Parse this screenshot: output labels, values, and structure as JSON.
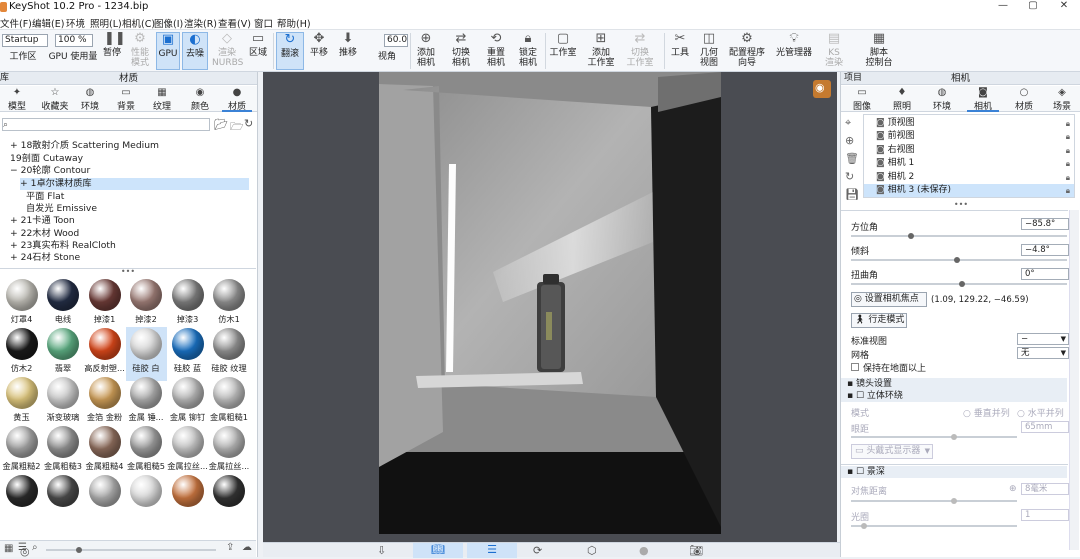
{
  "window": {
    "title": "KeyShot 10.2 Pro  - 1234.bip",
    "controls": [
      "—",
      "▢",
      "✕"
    ]
  },
  "menu": [
    "文件(F)",
    "编辑(E)",
    "环境",
    "照明(L)",
    "相机(C)",
    "图像(I)",
    "渲染(R)",
    "查看(V)",
    "窗口",
    "帮助(H)"
  ],
  "toolbar": {
    "startup": "Startup",
    "zoom": "100 %",
    "fov": "60.0",
    "items": [
      "工作区",
      "GPU 使用量",
      "暂停",
      "性能\n模式",
      "GPU",
      "去噪",
      "渲染\nNURBS",
      "区域",
      "翻滚",
      "平移",
      "推移",
      "视角",
      "添加\n相机",
      "切换\n相机",
      "重置\n相机",
      "锁定\n相机",
      "工作室",
      "添加\n工作室",
      "切换\n工作室",
      "工具",
      "几何\n视图",
      "配置程序\n向导",
      "光管理器",
      "KS\n渲染",
      "脚本\n控制台"
    ]
  },
  "left": {
    "header": "材质",
    "left_header": "库",
    "tabs": [
      "模型",
      "收藏夹",
      "环境",
      "背景",
      "纹理",
      "颜色",
      "材质"
    ],
    "search_placeholder": "",
    "tree": [
      {
        "label": "+ 18散射介质 Scattering Medium",
        "indent": 0
      },
      {
        "label": "19剖面 Cutaway",
        "indent": 0
      },
      {
        "label": "− 20轮廓 Contour",
        "indent": 0
      },
      {
        "label": "+ 1卓尔课材质库",
        "indent": 1,
        "highlight": true
      },
      {
        "label": "平面 Flat",
        "indent": 1
      },
      {
        "label": "自发光 Emissive",
        "indent": 1
      },
      {
        "label": "+ 21卡通 Toon",
        "indent": 0
      },
      {
        "label": "+ 22木材 Wood",
        "indent": 0
      },
      {
        "label": "+ 23真实布料 RealCloth",
        "indent": 0
      },
      {
        "label": "+ 24石材 Stone",
        "indent": 0
      }
    ],
    "materials": [
      {
        "label": "灯罩4",
        "color": "#b9b7b0"
      },
      {
        "label": "电线",
        "color": "#232d44"
      },
      {
        "label": "掉漆1",
        "color": "#6a3a36"
      },
      {
        "label": "掉漆2",
        "color": "#9a7a74"
      },
      {
        "label": "掉漆3",
        "color": "#7b7b7b"
      },
      {
        "label": "仿木1",
        "color": "#8d8d8d"
      },
      {
        "label": "仿木2",
        "color": "#1a1a1a"
      },
      {
        "label": "翡翠",
        "color": "#5aa97f"
      },
      {
        "label": "高反射塑...",
        "color": "#d4461a"
      },
      {
        "label": "硅胶 白",
        "color": "#d7d7d7"
      },
      {
        "label": "硅胶 蓝",
        "color": "#1a6fbf"
      },
      {
        "label": "硅胶 纹理",
        "color": "#8e8e8e"
      },
      {
        "label": "黄玉",
        "color": "#d9c27a"
      },
      {
        "label": "渐变玻璃",
        "color": "#c7c7c7"
      },
      {
        "label": "金箔 金粉",
        "color": "#c99a56"
      },
      {
        "label": "金属 锤...",
        "color": "#a9a9a9"
      },
      {
        "label": "金属 铆钉",
        "color": "#b2b2b2"
      },
      {
        "label": "金属粗糙1",
        "color": "#b9b9b9"
      },
      {
        "label": "金属粗糙2",
        "color": "#a0a0a0"
      },
      {
        "label": "金属粗糙3",
        "color": "#8f8f8f"
      },
      {
        "label": "金属粗糙4",
        "color": "#8a6a5a"
      },
      {
        "label": "金属粗糙5",
        "color": "#9a9a9a"
      },
      {
        "label": "金属拉丝...",
        "color": "#c0c0c0"
      },
      {
        "label": "金属拉丝...",
        "color": "#b0b0b0"
      },
      {
        "label": "",
        "color": "#2a2a2a"
      },
      {
        "label": "",
        "color": "#4a4a4a"
      },
      {
        "label": "",
        "color": "#a9a9a9"
      },
      {
        "label": "",
        "color": "#d9d9d9"
      },
      {
        "label": "",
        "color": "#c4723e"
      },
      {
        "label": "",
        "color": "#333333"
      }
    ]
  },
  "right": {
    "left_header": "项目",
    "header": "相机",
    "tabs": [
      "图像",
      "照明",
      "环境",
      "相机",
      "材质",
      "场景"
    ],
    "cameras": [
      "顶视图",
      "前视图",
      "右视图",
      "相机 1",
      "相机 2",
      "相机 3 (未保存)"
    ],
    "azimuth_label": "方位角",
    "azimuth": "−85.8°",
    "incline_label": "倾斜",
    "incline": "−4.8°",
    "twist_label": "扭曲角",
    "twist": "0°",
    "focus_button": "设置相机焦点",
    "focus_coords": "(1.09, 129.22, −46.59)",
    "walk_button": "行走模式",
    "std_view_label": "标准视图",
    "std_view_value": "−",
    "grid_label": "网格",
    "grid_value": "无",
    "keep_above_ground": "保持在地面以上",
    "lens_section": "镜头设置",
    "stereo": "立体环绕",
    "mode_label": "模式",
    "mode_opt1": "垂直并列",
    "mode_opt2": "水平并列",
    "eye_label": "眼距",
    "eye_value": "65mm",
    "headset": "头戴式显示器",
    "dof": "景深",
    "focus_dist_label": "对焦距离",
    "focus_dist_value": "8毫米",
    "aperture_label": "光圈",
    "aperture_value": "1"
  }
}
